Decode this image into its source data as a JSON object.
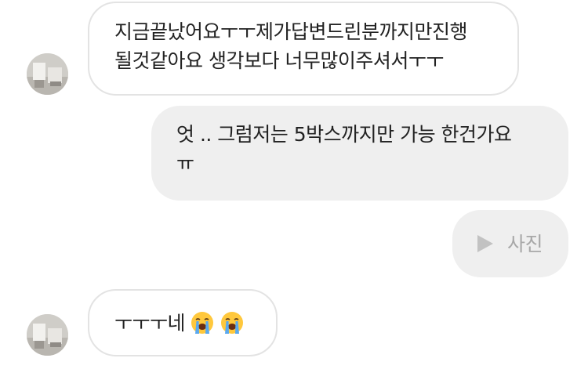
{
  "messages": [
    {
      "direction": "incoming",
      "text": "지금끝났어요ㅜㅜ제가답변드린분까지만진행\n될것같아요 생각보다 너무많이주셔서ㅜㅜ"
    },
    {
      "direction": "outgoing",
      "text": "엇 .. 그럼저는 5박스까지만 가능 한건가요\nㅠ"
    },
    {
      "direction": "outgoing",
      "type": "photo",
      "icon": "play-icon",
      "label": "사진"
    },
    {
      "direction": "incoming",
      "text": "ㅜㅜㅜ네",
      "emojis": [
        "loudly-crying-face-emoji",
        "loudly-crying-face-emoji"
      ]
    }
  ],
  "colors": {
    "incoming_bubble_bg": "#ffffff",
    "incoming_bubble_border": "#e3e3e3",
    "outgoing_bubble_bg": "#efefef",
    "text": "#222222",
    "photo_label": "#a8a8a8",
    "emoji_face": "#ffc83d",
    "emoji_tears": "#5aa9f0"
  }
}
